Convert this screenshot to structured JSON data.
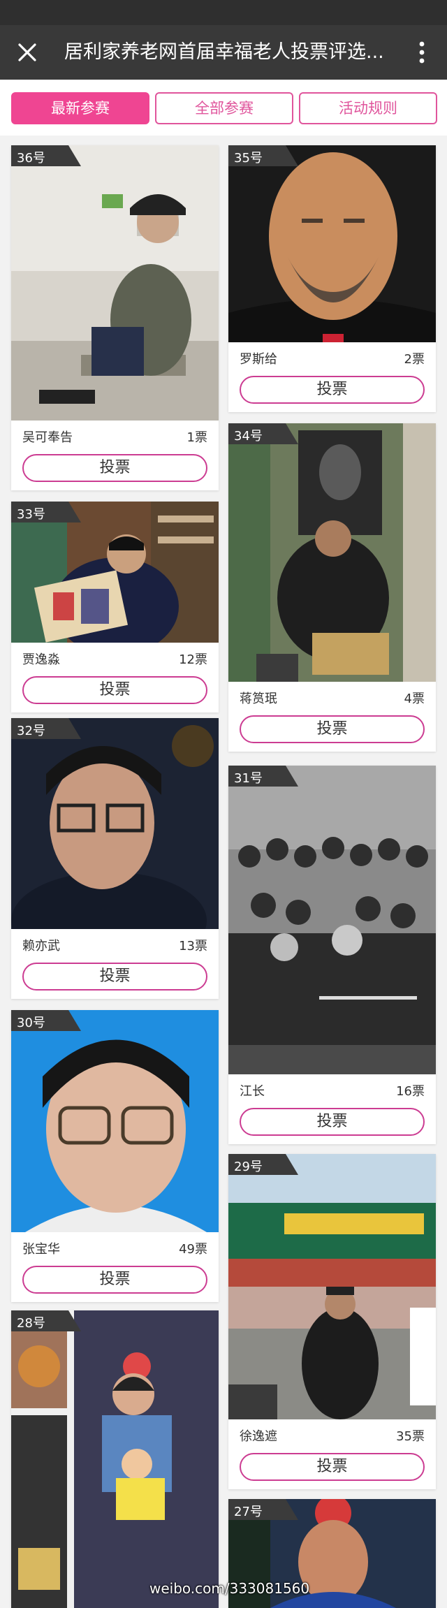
{
  "header": {
    "title": "居利家养老网首届幸福老人投票评选...",
    "close_icon": "close-icon",
    "more_icon": "more-vertical-icon"
  },
  "tabs": [
    {
      "label": "最新参赛",
      "active": true
    },
    {
      "label": "全部参赛",
      "active": false
    },
    {
      "label": "活动规则",
      "active": false
    }
  ],
  "vote_button_label": "投票",
  "colors": {
    "accent": "#ef4592",
    "header_bg": "#393939",
    "card_badge_bg": "#3b3b3b"
  },
  "entries": [
    {
      "num": "36号",
      "name": "吴可奉告",
      "votes": "1票",
      "photo": "photo"
    },
    {
      "num": "35号",
      "name": "罗斯给",
      "votes": "2票",
      "photo": "photo"
    },
    {
      "num": "34号",
      "name": "蒋筼珉",
      "votes": "4票",
      "photo": "photo"
    },
    {
      "num": "33号",
      "name": "贾逸淼",
      "votes": "12票",
      "photo": "photo"
    },
    {
      "num": "32号",
      "name": "赖亦武",
      "votes": "13票",
      "photo": "photo"
    },
    {
      "num": "31号",
      "name": "江长",
      "votes": "16票",
      "photo": "photo"
    },
    {
      "num": "30号",
      "name": "张宝华",
      "votes": "49票",
      "photo": "photo"
    },
    {
      "num": "29号",
      "name": "徐逸遮",
      "votes": "35票",
      "photo": "photo"
    },
    {
      "num": "28号",
      "photo": "photo"
    },
    {
      "num": "27号",
      "photo": "photo"
    }
  ],
  "watermark": "weibo.com/333081560"
}
